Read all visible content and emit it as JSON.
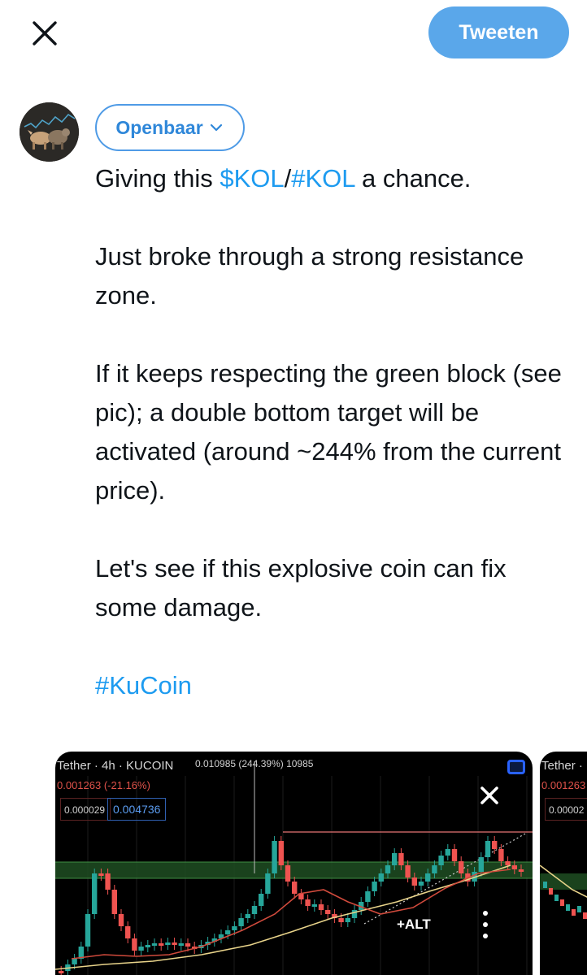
{
  "header": {
    "close_icon": "close-icon",
    "tweet_button_label": "Tweeten"
  },
  "composer": {
    "avatar_icon": "bull-bear-avatar",
    "audience_label": "Openbaar",
    "text": {
      "p1_before": "Giving this ",
      "p1_link1": "$KOL",
      "p1_slash": "/",
      "p1_link2": "#KOL",
      "p1_after": " a chance.",
      "p2": "Just broke through a strong resistance zone.",
      "p3": "If it keeps respecting the green block (see pic); a double bottom target will be activated (around ~244% from the current price).",
      "p4": "Let's see if this explosive coin can fix some damage.",
      "p5_link": "#KuCoin"
    }
  },
  "media": {
    "card1": {
      "chart_title": "Tether · 4h · KUCOIN",
      "target_readout": "0.010985 (244.39%) 10985",
      "change_readout": "0.001263 (-21.16%)",
      "box_value_1": "0.000029",
      "box_value_2": "0.004736",
      "alt_label": "+ALT",
      "close_icon": "close-icon",
      "more_icon": "more-vertical-icon"
    },
    "card2": {
      "chart_title": "Tether ·",
      "change_readout": "0.001263",
      "box_value": "0.00002"
    },
    "colors": {
      "bull": "#26a69a",
      "bear": "#ef5350",
      "zone": "#1f4d22",
      "ma_yellow": "#e8d38a",
      "ma_red": "#d04a3c",
      "resistance": "#e57373"
    }
  }
}
